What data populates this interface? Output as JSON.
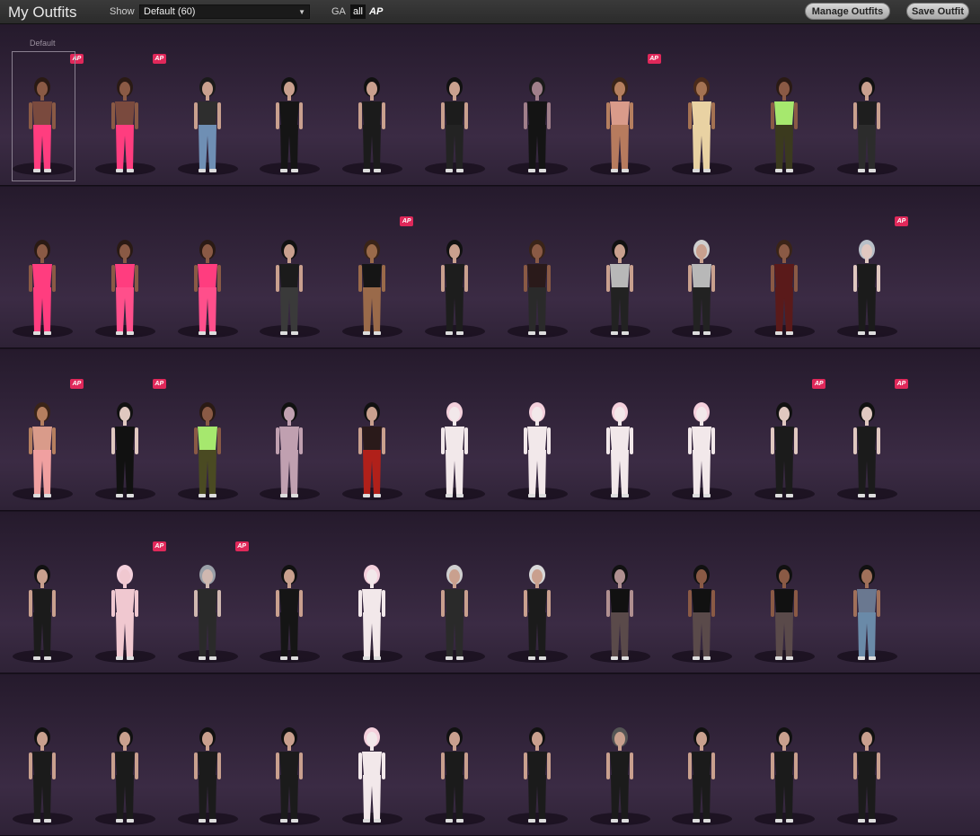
{
  "header": {
    "title": "My Outfits",
    "show_label": "Show",
    "show_select_value": "Default (60)",
    "ga_label": "GA",
    "filter_all_label": "all",
    "filter_ap_label": "AP",
    "manage_button": "Manage Outfits",
    "save_button": "Save Outfit"
  },
  "default_label": "Default",
  "ap_badge_text": "AP",
  "rows": [
    {
      "outfits": [
        {
          "top": "#7a4a3e",
          "bottom": "#ff3d7f",
          "skin": "#8a5a45",
          "hair": "#2a1a14",
          "ap": true,
          "selected": true
        },
        {
          "top": "#7a4a3e",
          "bottom": "#ff3d7f",
          "skin": "#8a5a45",
          "hair": "#2a1a14",
          "ap": true
        },
        {
          "top": "#2e2e2e",
          "bottom": "#6f8fb4",
          "skin": "#c9a08e",
          "hair": "#1a1a1a",
          "ap": false
        },
        {
          "top": "#151515",
          "bottom": "#151515",
          "skin": "#c9a08e",
          "hair": "#111",
          "ap": false
        },
        {
          "top": "#1b1b1b",
          "bottom": "#1b1b1b",
          "skin": "#c9a08e",
          "hair": "#111",
          "ap": false
        },
        {
          "top": "#1c1c1c",
          "bottom": "#232323",
          "skin": "#c9a08e",
          "hair": "#111",
          "ap": false
        },
        {
          "top": "#141414",
          "bottom": "#141414",
          "skin": "#a07f8a",
          "hair": "#1a1a1a",
          "ap": false
        },
        {
          "top": "#d99b8a",
          "bottom": "#b77b5e",
          "skin": "#b57f5f",
          "hair": "#3a2418",
          "ap": true
        },
        {
          "top": "#e9d2a3",
          "bottom": "#e9d2a3",
          "skin": "#a47252",
          "hair": "#4a2a1a",
          "ap": false
        },
        {
          "top": "#a6e86e",
          "bottom": "#3b3a1e",
          "skin": "#8a5a45",
          "hair": "#2a1a14",
          "ap": false
        },
        {
          "top": "#1e1e1e",
          "bottom": "#2c2c2c",
          "skin": "#c9a08e",
          "hair": "#111",
          "ap": false
        }
      ]
    },
    {
      "outfits": [
        {
          "top": "#ff3d7f",
          "bottom": "#ff3d7f",
          "skin": "#8a5a45",
          "hair": "#2a1a14",
          "ap": false
        },
        {
          "top": "#ff3d7f",
          "bottom": "#ff4f8b",
          "skin": "#8a5a45",
          "hair": "#2a1a14",
          "ap": false
        },
        {
          "top": "#ff3d7f",
          "bottom": "#ff4f8b",
          "skin": "#8a5a45",
          "hair": "#2a1a14",
          "ap": false
        },
        {
          "top": "#1b1b1b",
          "bottom": "#3a3a3a",
          "skin": "#c9a08e",
          "hair": "#111",
          "ap": false
        },
        {
          "top": "#151515",
          "bottom": "#9a6a4a",
          "skin": "#9a6a4a",
          "hair": "#3a2418",
          "ap": true
        },
        {
          "top": "#1d1d1d",
          "bottom": "#1d1d1d",
          "skin": "#c9a08e",
          "hair": "#111",
          "ap": false
        },
        {
          "top": "#2a1a1a",
          "bottom": "#2a2a2a",
          "skin": "#8a5a45",
          "hair": "#3a2418",
          "ap": false
        },
        {
          "top": "#b8b8b8",
          "bottom": "#222",
          "skin": "#c9a08e",
          "hair": "#111",
          "ap": false
        },
        {
          "top": "#b8b8b8",
          "bottom": "#222",
          "skin": "#c9a08e",
          "hair": "#cfcfcf",
          "ap": false
        },
        {
          "top": "#5a1a1a",
          "bottom": "#5a1a1a",
          "skin": "#8a5a45",
          "hair": "#3a2418",
          "ap": false
        },
        {
          "top": "#1b1b1b",
          "bottom": "#1b1b1b",
          "skin": "#e0c8c0",
          "hair": "#b8c0c8",
          "ap": true
        }
      ]
    },
    {
      "outfits": [
        {
          "top": "#d99b8a",
          "bottom": "#f0a0a0",
          "skin": "#b57f5f",
          "hair": "#3a2418",
          "ap": true
        },
        {
          "top": "#111",
          "bottom": "#111",
          "skin": "#e0c8c0",
          "hair": "#111",
          "ap": true
        },
        {
          "top": "#a6e86e",
          "bottom": "#4a4a22",
          "skin": "#8a5a45",
          "hair": "#2a1a14",
          "ap": false
        },
        {
          "top": "#c0a0b0",
          "bottom": "#c0a0b0",
          "skin": "#c0a0b0",
          "hair": "#111",
          "ap": false
        },
        {
          "top": "#2a1a1a",
          "bottom": "#b0201a",
          "skin": "#c9a08e",
          "hair": "#111",
          "ap": false
        },
        {
          "top": "#f2e8ea",
          "bottom": "#f2e8ea",
          "skin": "#f2e8ea",
          "hair": "#f4d0dc",
          "ap": false
        },
        {
          "top": "#f2e8ea",
          "bottom": "#f2e8ea",
          "skin": "#f2e8ea",
          "hair": "#f4d0dc",
          "ap": false
        },
        {
          "top": "#f2e8ea",
          "bottom": "#f2e8ea",
          "skin": "#f2e8ea",
          "hair": "#f4d0dc",
          "ap": false
        },
        {
          "top": "#f2e8ea",
          "bottom": "#f2e8ea",
          "skin": "#f2e8ea",
          "hair": "#f4d0dc",
          "ap": false
        },
        {
          "top": "#1b1b1b",
          "bottom": "#1b1b1b",
          "skin": "#e0c8c0",
          "hair": "#111",
          "ap": true
        },
        {
          "top": "#1b1b1b",
          "bottom": "#1b1b1b",
          "skin": "#e0c8c0",
          "hair": "#111",
          "ap": true
        }
      ]
    },
    {
      "outfits": [
        {
          "top": "#1b1b1b",
          "bottom": "#1b1b1b",
          "skin": "#c9a08e",
          "hair": "#111",
          "ap": false
        },
        {
          "top": "#f0c8d0",
          "bottom": "#f0c8d0",
          "skin": "#f0c8d0",
          "hair": "#f4d0dc",
          "ap": true
        },
        {
          "top": "#2a2a2a",
          "bottom": "#2a2a2a",
          "skin": "#d0b8b0",
          "hair": "#9aa0a8",
          "ap": true
        },
        {
          "top": "#151515",
          "bottom": "#151515",
          "skin": "#c9a08e",
          "hair": "#111",
          "ap": false
        },
        {
          "top": "#f2e8ea",
          "bottom": "#f2e8ea",
          "skin": "#f2e8ea",
          "hair": "#f4d0dc",
          "ap": false
        },
        {
          "top": "#2a2a2a",
          "bottom": "#2a2a2a",
          "skin": "#c9a08e",
          "hair": "#cfcfcf",
          "ap": false
        },
        {
          "top": "#1b1b1b",
          "bottom": "#1b1b1b",
          "skin": "#c9a08e",
          "hair": "#d8d8d8",
          "ap": false
        },
        {
          "top": "#111",
          "bottom": "#5a4a4a",
          "skin": "#b09090",
          "hair": "#111",
          "ap": false
        },
        {
          "top": "#111",
          "bottom": "#5a4a4a",
          "skin": "#8a5a45",
          "hair": "#111",
          "ap": false
        },
        {
          "top": "#111",
          "bottom": "#5a4a4a",
          "skin": "#8a5a45",
          "hair": "#111",
          "ap": false
        },
        {
          "top": "#6a7890",
          "bottom": "#6a8aa8",
          "skin": "#a0705a",
          "hair": "#111",
          "ap": false
        }
      ]
    },
    {
      "outfits": [
        {
          "top": "#1b1b1b",
          "bottom": "#1b1b1b",
          "skin": "#c9a08e",
          "hair": "#111",
          "ap": false
        },
        {
          "top": "#1b1b1b",
          "bottom": "#1b1b1b",
          "skin": "#c9a08e",
          "hair": "#111",
          "ap": false
        },
        {
          "top": "#1b1b1b",
          "bottom": "#1b1b1b",
          "skin": "#c9a08e",
          "hair": "#111",
          "ap": false
        },
        {
          "top": "#1b1b1b",
          "bottom": "#1b1b1b",
          "skin": "#c9a08e",
          "hair": "#111",
          "ap": false
        },
        {
          "top": "#f2e8ea",
          "bottom": "#f2e8ea",
          "skin": "#f2e8ea",
          "hair": "#f4d0dc",
          "ap": false
        },
        {
          "top": "#1b1b1b",
          "bottom": "#1b1b1b",
          "skin": "#c9a08e",
          "hair": "#111",
          "ap": false
        },
        {
          "top": "#1b1b1b",
          "bottom": "#1b1b1b",
          "skin": "#c9a08e",
          "hair": "#111",
          "ap": false
        },
        {
          "top": "#1b1b1b",
          "bottom": "#1b1b1b",
          "skin": "#c9a08e",
          "hair": "#555",
          "ap": false
        },
        {
          "top": "#1b1b1b",
          "bottom": "#1b1b1b",
          "skin": "#c9a08e",
          "hair": "#111",
          "ap": false
        },
        {
          "top": "#1b1b1b",
          "bottom": "#1b1b1b",
          "skin": "#c9a08e",
          "hair": "#111",
          "ap": false
        },
        {
          "top": "#1b1b1b",
          "bottom": "#1b1b1b",
          "skin": "#c9a08e",
          "hair": "#111",
          "ap": false
        }
      ]
    }
  ]
}
